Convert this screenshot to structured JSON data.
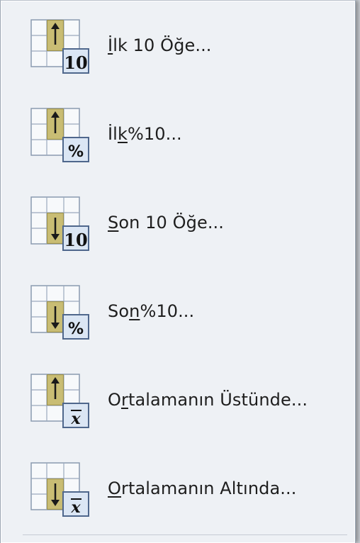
{
  "menu": {
    "items": [
      {
        "pre": "",
        "accel": "İ",
        "post": "lk 10 Öğe...",
        "icon": "top-10-items-icon",
        "arrow": "up",
        "badge": "10"
      },
      {
        "pre": "İl",
        "accel": "k",
        "post": " %10...",
        "icon": "top-10-percent-icon",
        "arrow": "up",
        "badge": "%"
      },
      {
        "pre": "",
        "accel": "S",
        "post": "on 10 Öğe...",
        "icon": "bottom-10-items-icon",
        "arrow": "down",
        "badge": "10"
      },
      {
        "pre": "So",
        "accel": "n",
        "post": " %10...",
        "icon": "bottom-10-percent-icon",
        "arrow": "down",
        "badge": "%"
      },
      {
        "pre": "O",
        "accel": "r",
        "post": "talamanın Üstünde...",
        "icon": "above-average-icon",
        "arrow": "up",
        "badge": "x̄"
      },
      {
        "pre": "",
        "accel": "O",
        "post": "rtalamanın Altında...",
        "icon": "below-average-icon",
        "arrow": "down",
        "badge": "x̄"
      }
    ]
  },
  "colors": {
    "menu_background": "#eef1f5",
    "grid_line": "#8a9ab0",
    "highlight_cell": "#c8bd78",
    "badge_fill": "#dbe6f4",
    "badge_border": "#5a7092",
    "text": "#1e1e1e"
  }
}
